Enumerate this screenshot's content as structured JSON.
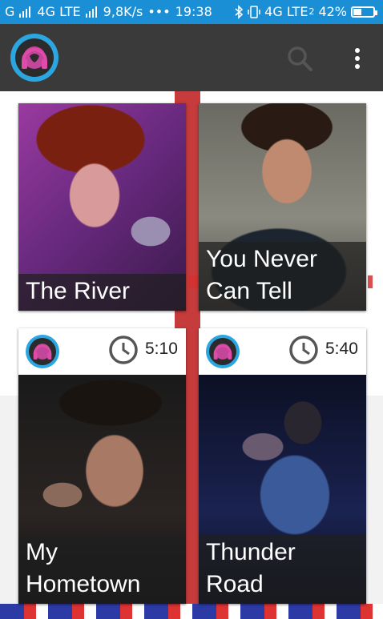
{
  "status_bar": {
    "network_left": "G",
    "network_type": "4G LTE",
    "speed": "9,8K/s",
    "dots": "•••",
    "time": "19:38",
    "network_right": "4G LTE",
    "sim": "2",
    "battery_percent": "42%",
    "battery_level": 0.42
  },
  "app_bar": {
    "logo_icon": "headphones-logo-icon",
    "search_icon": "search-icon",
    "overflow_icon": "more-vert-icon"
  },
  "cards": [
    {
      "title": "The River"
    },
    {
      "title": "You Never Can Tell"
    },
    {
      "title": "My Hometown",
      "duration": "5:10"
    },
    {
      "title": "Thunder Road",
      "duration": "5:40"
    }
  ]
}
